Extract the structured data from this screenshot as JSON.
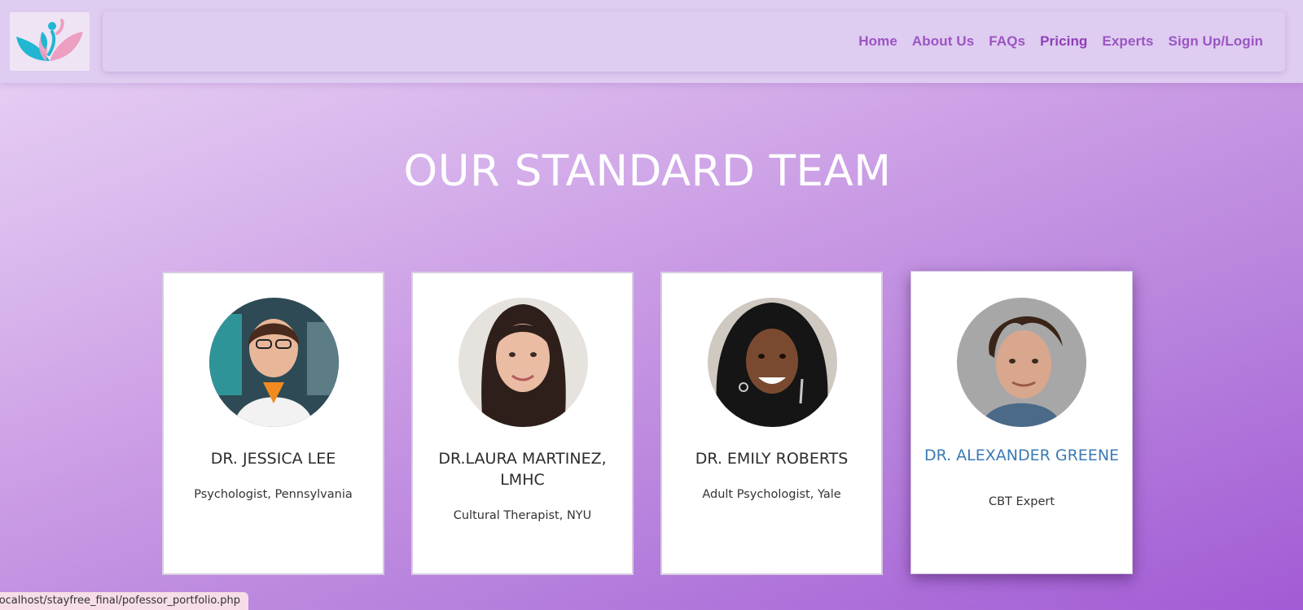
{
  "nav": {
    "items": [
      {
        "label": "Home"
      },
      {
        "label": "About Us"
      },
      {
        "label": "FAQs"
      },
      {
        "label": "Pricing"
      },
      {
        "label": "Experts"
      },
      {
        "label": "Sign Up/Login"
      }
    ]
  },
  "main": {
    "heading": "OUR STANDARD TEAM",
    "cards": [
      {
        "name": "DR. JESSICA LEE",
        "role": "Psychologist, Pennsylvania"
      },
      {
        "name": "DR.LAURA MARTINEZ, LMHC",
        "role": "Cultural Therapist, NYU"
      },
      {
        "name": "DR. EMILY ROBERTS",
        "role": "Adult Psychologist, Yale"
      },
      {
        "name": "DR. ALEXANDER GREENE",
        "role": "CBT Expert"
      }
    ]
  },
  "status_bar": {
    "url": "localhost/stayfree_final/pofessor_portfolio.php"
  },
  "colors": {
    "nav_link": "#9b55c2",
    "featured_name": "#3b7ab4",
    "logo_teal": "#21b6d2",
    "logo_pink": "#ec9fc0"
  }
}
